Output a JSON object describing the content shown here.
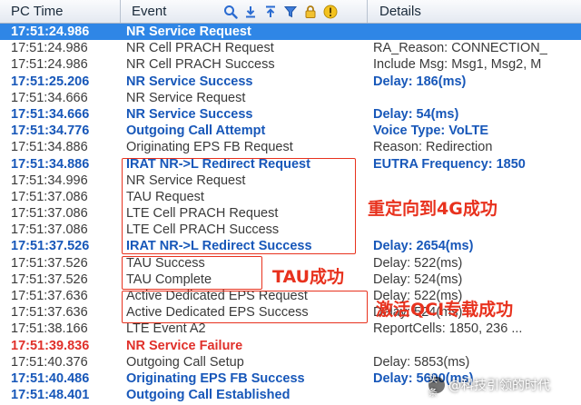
{
  "header": {
    "col_time": "PC Time",
    "col_event": "Event",
    "col_details": "Details",
    "toolbar_icons": [
      "search-icon",
      "download-icon",
      "upload-icon",
      "filter-icon",
      "lock-icon",
      "warning-icon"
    ]
  },
  "colors": {
    "selection": "#2f86e6",
    "blue_text": "#1757b9",
    "red_text": "#e0302a",
    "annotation": "#e8321e"
  },
  "rows": [
    {
      "time": "17:51:24.986",
      "event": "NR Service Request",
      "details": "",
      "style": "sel"
    },
    {
      "time": "17:51:24.986",
      "event": "NR Cell PRACH Request",
      "details": "RA_Reason: CONNECTION_",
      "style": "gray"
    },
    {
      "time": "17:51:24.986",
      "event": "NR Cell PRACH Success",
      "details": "Include Msg: Msg1, Msg2, M",
      "style": "gray"
    },
    {
      "time": "17:51:25.206",
      "event": "NR Service Success",
      "details": "Delay: 186(ms)",
      "style": "blue"
    },
    {
      "time": "17:51:34.666",
      "event": "NR Service Request",
      "details": "",
      "style": "gray"
    },
    {
      "time": "17:51:34.666",
      "event": "NR Service Success",
      "details": "Delay: 54(ms)",
      "style": "blue"
    },
    {
      "time": "17:51:34.776",
      "event": "Outgoing Call Attempt",
      "details": "Voice Type: VoLTE",
      "style": "blue"
    },
    {
      "time": "17:51:34.886",
      "event": "Originating EPS FB Request",
      "details": "Reason: Redirection",
      "style": "gray"
    },
    {
      "time": "17:51:34.886",
      "event": "IRAT NR->L Redirect Request",
      "details": "EUTRA Frequency: 1850",
      "style": "blue"
    },
    {
      "time": "17:51:34.996",
      "event": "NR Service Request",
      "details": "",
      "style": "gray"
    },
    {
      "time": "17:51:37.086",
      "event": "TAU Request",
      "details": "",
      "style": "gray"
    },
    {
      "time": "17:51:37.086",
      "event": "LTE Cell PRACH Request",
      "details": "",
      "style": "gray"
    },
    {
      "time": "17:51:37.086",
      "event": "LTE Cell PRACH Success",
      "details": "",
      "style": "gray"
    },
    {
      "time": "17:51:37.526",
      "event": "IRAT NR->L Redirect Success",
      "details": "Delay: 2654(ms)",
      "style": "blue"
    },
    {
      "time": "17:51:37.526",
      "event": "TAU Success",
      "details": "Delay: 522(ms)",
      "style": "gray"
    },
    {
      "time": "17:51:37.526",
      "event": "TAU Complete",
      "details": "Delay: 524(ms)",
      "style": "gray"
    },
    {
      "time": "17:51:37.636",
      "event": "Active Dedicated EPS Request",
      "details": "Delay: 522(ms)",
      "style": "gray"
    },
    {
      "time": "17:51:37.636",
      "event": "Active Dedicated EPS Success",
      "details": "Delay: 524(ms)",
      "style": "gray"
    },
    {
      "time": "17:51:38.166",
      "event": "LTE Event A2",
      "details": "ReportCells: 1850, 236 ...",
      "style": "gray"
    },
    {
      "time": "17:51:39.836",
      "event": "NR Service Failure",
      "details": "",
      "style": "red"
    },
    {
      "time": "17:51:40.376",
      "event": "Outgoing Call Setup",
      "details": "Delay: 5853(ms)",
      "style": "gray"
    },
    {
      "time": "17:51:40.486",
      "event": "Originating EPS FB Success",
      "details": "Delay: 5600(ms)",
      "style": "blue"
    },
    {
      "time": "17:51:48.401",
      "event": "Outgoing Call Established",
      "details": "",
      "style": "blue"
    }
  ],
  "annotations": {
    "redirect": "重定向到4G成功",
    "tau": "TAU成功",
    "qci": "激活QCI专载成功"
  },
  "watermark": {
    "logo": "头条",
    "text": "@科技引领的时代"
  }
}
